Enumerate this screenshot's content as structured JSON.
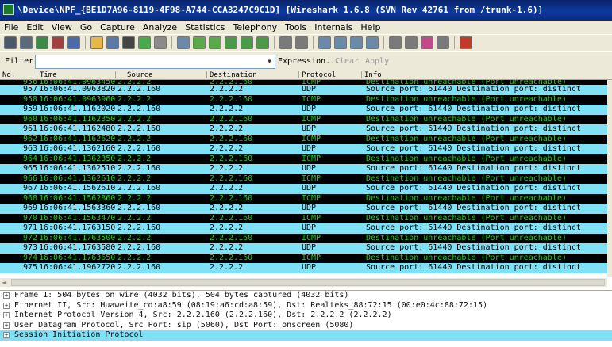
{
  "window": {
    "title": "\\Device\\NPF_{BE1D7A96-8119-4F98-A744-CCA3247C9C1D]   [Wireshark 1.6.8  (SVN Rev 42761 from /trunk-1.6)]"
  },
  "menu": [
    "File",
    "Edit",
    "View",
    "Go",
    "Capture",
    "Analyze",
    "Statistics",
    "Telephony",
    "Tools",
    "Internals",
    "Help"
  ],
  "toolbar": {
    "icons": [
      {
        "name": "interfaces-icon",
        "color": "#4a5a6a"
      },
      {
        "name": "capture-options-icon",
        "color": "#5a6a7a"
      },
      {
        "name": "start-capture-icon",
        "color": "#3a8a4a"
      },
      {
        "name": "stop-capture-icon",
        "color": "#a04040"
      },
      {
        "name": "restart-capture-icon",
        "color": "#4a6aaa"
      },
      {
        "sep": true
      },
      {
        "name": "open-file-icon",
        "color": "#e6b84a"
      },
      {
        "name": "save-file-icon",
        "color": "#5a7aaa"
      },
      {
        "name": "close-file-icon",
        "color": "#444444"
      },
      {
        "name": "reload-icon",
        "color": "#4aaa4a"
      },
      {
        "name": "print-icon",
        "color": "#8a8a8a"
      },
      {
        "sep": true
      },
      {
        "name": "find-packet-icon",
        "color": "#6a8aaa"
      },
      {
        "name": "go-back-icon",
        "color": "#5aaa4a"
      },
      {
        "name": "go-forward-icon",
        "color": "#5aaa4a"
      },
      {
        "name": "go-to-packet-icon",
        "color": "#4a9a4a"
      },
      {
        "name": "go-first-icon",
        "color": "#4a9a4a"
      },
      {
        "name": "go-last-icon",
        "color": "#4a9a4a"
      },
      {
        "sep": true
      },
      {
        "name": "colorize-icon",
        "color": "#7a7a7a"
      },
      {
        "name": "autoscroll-icon",
        "color": "#7a7a7a"
      },
      {
        "sep": true
      },
      {
        "name": "zoom-in-icon",
        "color": "#6a8aaa"
      },
      {
        "name": "zoom-out-icon",
        "color": "#6a8aaa"
      },
      {
        "name": "zoom-normal-icon",
        "color": "#6a8aaa"
      },
      {
        "name": "resize-columns-icon",
        "color": "#6a8aaa"
      },
      {
        "sep": true
      },
      {
        "name": "capture-filters-icon",
        "color": "#7a7a7a"
      },
      {
        "name": "display-filters-icon",
        "color": "#7a7a7a"
      },
      {
        "name": "coloring-rules-icon",
        "color": "#c04a8a"
      },
      {
        "name": "preferences-icon",
        "color": "#7a7a7a"
      },
      {
        "sep": true
      },
      {
        "name": "help-icon",
        "color": "#c0392b"
      }
    ]
  },
  "filter": {
    "label": "Filter:",
    "value": "",
    "dropdown_glyph": "▼",
    "expression_label": "Expression...",
    "clear_label": "Clear",
    "apply_label": "Apply"
  },
  "columns": [
    "No.",
    "Time",
    "Source",
    "Destination",
    "Protocol",
    "Info"
  ],
  "colors": {
    "udp_bg": "#7fe1f6",
    "icmp_bg": "#000000",
    "icmp_fg": "#22cc22"
  },
  "packets": [
    {
      "no": "956",
      "time": "16:06:41.0963450",
      "src": "2.2.2.2",
      "dst": "2.2.2.160",
      "proto": "ICMP",
      "info": "Destination unreachable (Port unreachable)",
      "partial": true
    },
    {
      "no": "957",
      "time": "16:06:41.0963820",
      "src": "2.2.2.160",
      "dst": "2.2.2.2",
      "proto": "UDP",
      "info": "Source port: 61440  Destination port: distinct"
    },
    {
      "no": "958",
      "time": "16:06:41.0963960",
      "src": "2.2.2.2",
      "dst": "2.2.2.160",
      "proto": "ICMP",
      "info": "Destination unreachable (Port unreachable)"
    },
    {
      "no": "959",
      "time": "16:06:41.1162020",
      "src": "2.2.2.160",
      "dst": "2.2.2.2",
      "proto": "UDP",
      "info": "Source port: 61440  Destination port: distinct"
    },
    {
      "no": "960",
      "time": "16:06:41.1162350",
      "src": "2.2.2.2",
      "dst": "2.2.2.160",
      "proto": "ICMP",
      "info": "Destination unreachable (Port unreachable)"
    },
    {
      "no": "961",
      "time": "16:06:41.1162480",
      "src": "2.2.2.160",
      "dst": "2.2.2.2",
      "proto": "UDP",
      "info": "Source port: 61440  Destination port: distinct"
    },
    {
      "no": "962",
      "time": "16:06:41.1162620",
      "src": "2.2.2.2",
      "dst": "2.2.2.160",
      "proto": "ICMP",
      "info": "Destination unreachable (Port unreachable)"
    },
    {
      "no": "963",
      "time": "16:06:41.1362160",
      "src": "2.2.2.160",
      "dst": "2.2.2.2",
      "proto": "UDP",
      "info": "Source port: 61440  Destination port: distinct"
    },
    {
      "no": "964",
      "time": "16:06:41.1362350",
      "src": "2.2.2.2",
      "dst": "2.2.2.160",
      "proto": "ICMP",
      "info": "Destination unreachable (Port unreachable)"
    },
    {
      "no": "965",
      "time": "16:06:41.1362510",
      "src": "2.2.2.160",
      "dst": "2.2.2.2",
      "proto": "UDP",
      "info": "Source port: 61440  Destination port: distinct"
    },
    {
      "no": "966",
      "time": "16:06:41.1362610",
      "src": "2.2.2.2",
      "dst": "2.2.2.160",
      "proto": "ICMP",
      "info": "Destination unreachable (Port unreachable)"
    },
    {
      "no": "967",
      "time": "16:06:41.1562610",
      "src": "2.2.2.160",
      "dst": "2.2.2.2",
      "proto": "UDP",
      "info": "Source port: 61440  Destination port: distinct"
    },
    {
      "no": "968",
      "time": "16:06:41.1562860",
      "src": "2.2.2.2",
      "dst": "2.2.2.160",
      "proto": "ICMP",
      "info": "Destination unreachable (Port unreachable)"
    },
    {
      "no": "969",
      "time": "16:06:41.1563360",
      "src": "2.2.2.160",
      "dst": "2.2.2.2",
      "proto": "UDP",
      "info": "Source port: 61440  Destination port: distinct"
    },
    {
      "no": "970",
      "time": "16:06:41.1563470",
      "src": "2.2.2.2",
      "dst": "2.2.2.160",
      "proto": "ICMP",
      "info": "Destination unreachable (Port unreachable)"
    },
    {
      "no": "971",
      "time": "16:06:41.1763150",
      "src": "2.2.2.160",
      "dst": "2.2.2.2",
      "proto": "UDP",
      "info": "Source port: 61440  Destination port: distinct"
    },
    {
      "no": "972",
      "time": "16:06:41.1763500",
      "src": "2.2.2.2",
      "dst": "2.2.2.160",
      "proto": "ICMP",
      "info": "Destination unreachable (Port unreachable)"
    },
    {
      "no": "973",
      "time": "16:06:41.1763580",
      "src": "2.2.2.160",
      "dst": "2.2.2.2",
      "proto": "UDP",
      "info": "Source port: 61440  Destination port: distinct"
    },
    {
      "no": "974",
      "time": "16:06:41.1763650",
      "src": "2.2.2.2",
      "dst": "2.2.2.160",
      "proto": "ICMP",
      "info": "Destination unreachable (Port unreachable)"
    },
    {
      "no": "975",
      "time": "16:06:41.1962720",
      "src": "2.2.2.160",
      "dst": "2.2.2.2",
      "proto": "UDP",
      "info": "Source port: 61440  Destination port: distinct"
    }
  ],
  "details": [
    {
      "text": "Frame 1: 504 bytes on wire (4032 bits), 504 bytes captured (4032 bits)",
      "selected": false
    },
    {
      "text": "Ethernet II, Src: Huaweite_cd:a8:59 (08:19:a6:cd:a8:59), Dst: Realteks_88:72:15 (00:e0:4c:88:72:15)",
      "selected": false
    },
    {
      "text": "Internet Protocol Version 4, Src: 2.2.2.160 (2.2.2.160), Dst: 2.2.2.2 (2.2.2.2)",
      "selected": false
    },
    {
      "text": "User Datagram Protocol, Src Port: sip (5060), Dst Port: onscreen (5080)",
      "selected": false
    },
    {
      "text": "Session Initiation Protocol",
      "selected": true
    }
  ],
  "expander_glyph": "+",
  "scroll_left_glyph": "◄"
}
